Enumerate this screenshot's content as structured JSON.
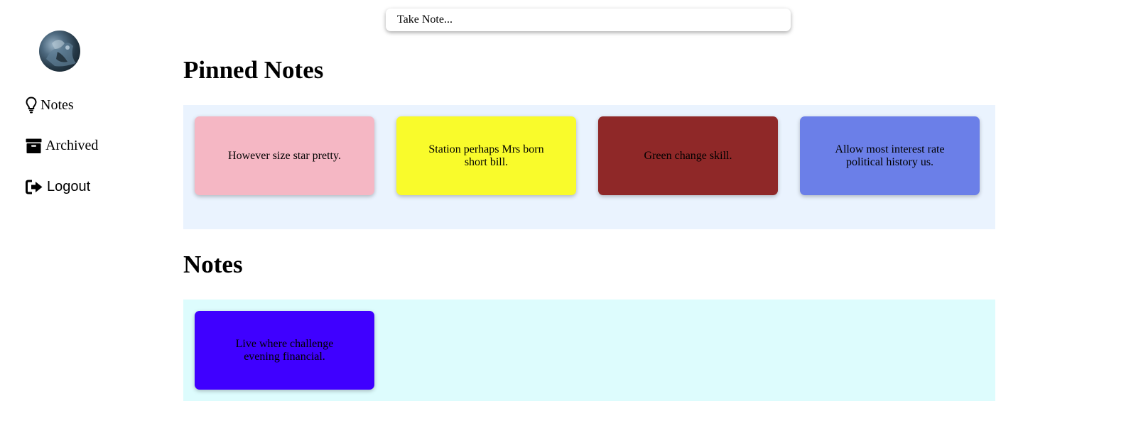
{
  "search": {
    "placeholder": "Take Note..."
  },
  "sidebar": {
    "items": [
      {
        "label": "Notes",
        "icon": "lightbulb-icon"
      },
      {
        "label": "Archived",
        "icon": "archive-box-icon"
      },
      {
        "label": "Logout",
        "icon": "logout-icon"
      }
    ]
  },
  "pinned": {
    "title": "Pinned Notes",
    "background": "#eaf3fe",
    "notes": [
      {
        "text": "However size star pretty.",
        "color": "#f5b7c4"
      },
      {
        "text": "Station perhaps Mrs born short bill.",
        "color": "#f9fb2b"
      },
      {
        "text": "Green change skill.",
        "color": "#8f2828"
      },
      {
        "text": "Allow most interest rate political history us.",
        "color": "#6b7fe8"
      }
    ]
  },
  "others": {
    "title": "Notes",
    "background": "#ddfcfd",
    "notes": [
      {
        "text": "Live where challenge evening financial.",
        "color": "#3f00ff"
      }
    ]
  }
}
